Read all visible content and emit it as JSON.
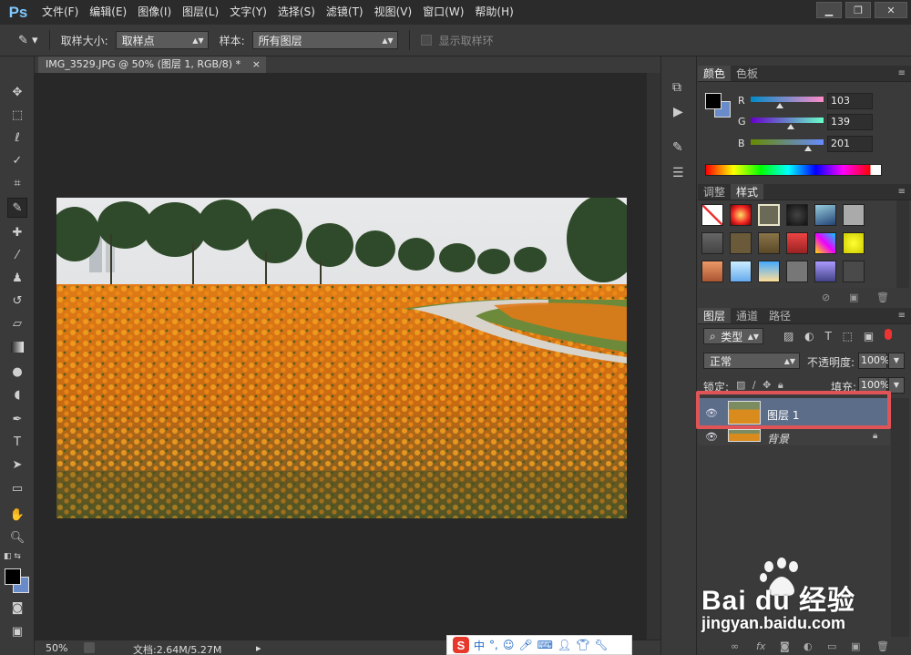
{
  "app": {
    "logo": "Ps"
  },
  "menu": [
    "文件(F)",
    "编辑(E)",
    "图像(I)",
    "图层(L)",
    "文字(Y)",
    "选择(S)",
    "滤镜(T)",
    "视图(V)",
    "窗口(W)",
    "帮助(H)"
  ],
  "window_controls": {
    "minimize": "▁",
    "restore": "❐",
    "close": "✕"
  },
  "options": {
    "sample_size_label": "取样大小:",
    "sample_size_value": "取样点",
    "sample_label": "样本:",
    "sample_value": "所有图层",
    "show_ring_label": "显示取样环"
  },
  "document": {
    "tab_title": "IMG_3529.JPG @ 50% (图层 1, RGB/8) *",
    "tab_close": "×",
    "zoom": "50%",
    "doc_size": "文档:2.64M/5.27M"
  },
  "color_panel": {
    "tabs": [
      "颜色",
      "色板"
    ],
    "foreground": "#000000",
    "background": "#6a8bc9",
    "channels": [
      {
        "label": "R",
        "value": "103",
        "level": 0.404
      },
      {
        "label": "G",
        "value": "139",
        "level": 0.545
      },
      {
        "label": "B",
        "value": "201",
        "level": 0.788
      }
    ]
  },
  "styles_panel": {
    "tabs": [
      "调整",
      "样式"
    ]
  },
  "layers_panel": {
    "tabs": [
      "图层",
      "通道",
      "路径"
    ],
    "filter_label": "类型",
    "blend_mode": "正常",
    "opacity_label": "不透明度:",
    "opacity_value": "100%",
    "lock_label": "锁定:",
    "fill_label": "填充:",
    "fill_value": "100%",
    "layers": [
      {
        "name": "图层 1",
        "selected": true
      },
      {
        "name": "背景",
        "selected": false,
        "locked": true
      }
    ]
  },
  "ime": {
    "logo": "S",
    "mode": "中",
    "punct": "°,"
  },
  "watermark": {
    "brand": "Bai du 经验",
    "url": "jingyan.baidu.com"
  },
  "colors": {
    "accent_selection": "#5c6d89",
    "highlight_box": "#e05458",
    "ps_blue": "#7ec8ff"
  }
}
